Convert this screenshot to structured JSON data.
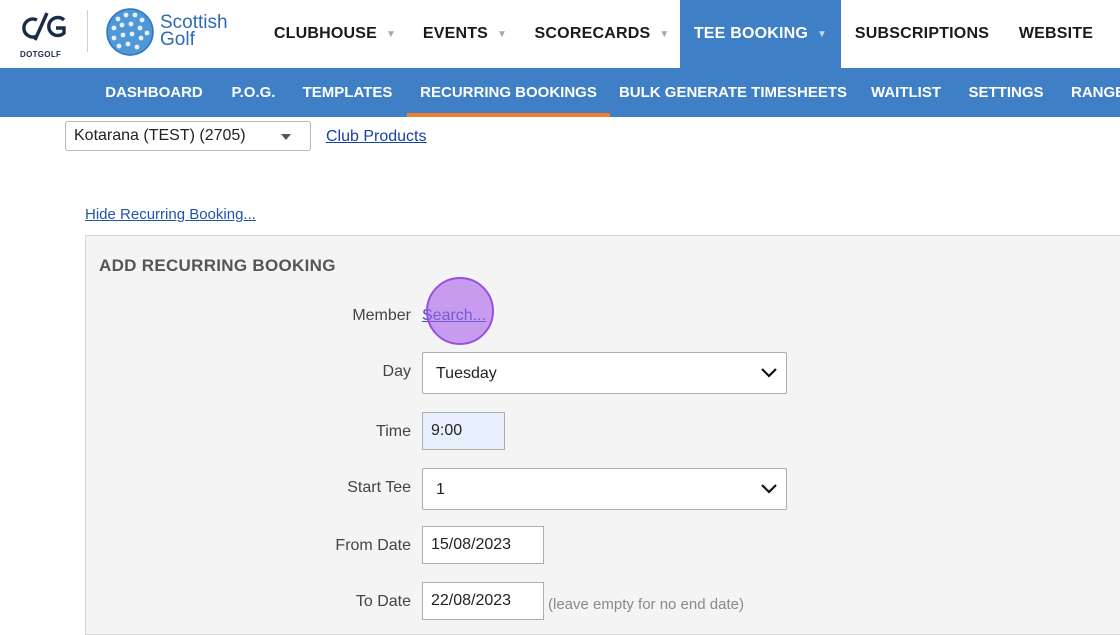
{
  "logos": {
    "dotgolf_caption": "DOTGOLF",
    "scottish_golf_line1": "Scottish",
    "scottish_golf_line2": "Golf"
  },
  "top_nav": [
    {
      "label": "CLUBHOUSE",
      "has_caret": true,
      "active": false
    },
    {
      "label": "EVENTS",
      "has_caret": true,
      "active": false
    },
    {
      "label": "SCORECARDS",
      "has_caret": true,
      "active": false
    },
    {
      "label": "TEE BOOKING",
      "has_caret": true,
      "active": true
    },
    {
      "label": "SUBSCRIPTIONS",
      "has_caret": false,
      "active": false
    },
    {
      "label": "WEBSITE",
      "has_caret": false,
      "active": false
    }
  ],
  "sub_nav": [
    {
      "label": "DASHBOARD",
      "active": false
    },
    {
      "label": "P.O.G.",
      "active": false
    },
    {
      "label": "TEMPLATES",
      "active": false
    },
    {
      "label": "RECURRING BOOKINGS",
      "active": true
    },
    {
      "label": "BULK GENERATE TIMESHEETS",
      "active": false
    },
    {
      "label": "WAITLIST",
      "active": false
    },
    {
      "label": "SETTINGS",
      "active": false
    },
    {
      "label": "RANGE",
      "active": false
    }
  ],
  "club_select": {
    "value": "Kotarana (TEST) (2705)"
  },
  "club_products_link": "Club Products",
  "hide_link": "Hide Recurring Booking...",
  "form": {
    "title": "ADD RECURRING BOOKING",
    "member_label": "Member",
    "member_search": "Search...",
    "day_label": "Day",
    "day_value": "Tuesday",
    "time_label": "Time",
    "time_value": "9:00",
    "start_tee_label": "Start Tee",
    "start_tee_value": "1",
    "from_date_label": "From Date",
    "from_date_value": "15/08/2023",
    "to_date_label": "To Date",
    "to_date_value": "22/08/2023",
    "to_date_hint": "(leave empty for no end date)"
  },
  "colors": {
    "primary_blue": "#3f7fc5",
    "active_underline": "#f0812a",
    "link_blue": "#1f55ac",
    "cursor_highlight": "#a860eb"
  },
  "icons": {
    "caret": "caret-down-icon",
    "select_chevron": "chevron-down-icon"
  }
}
